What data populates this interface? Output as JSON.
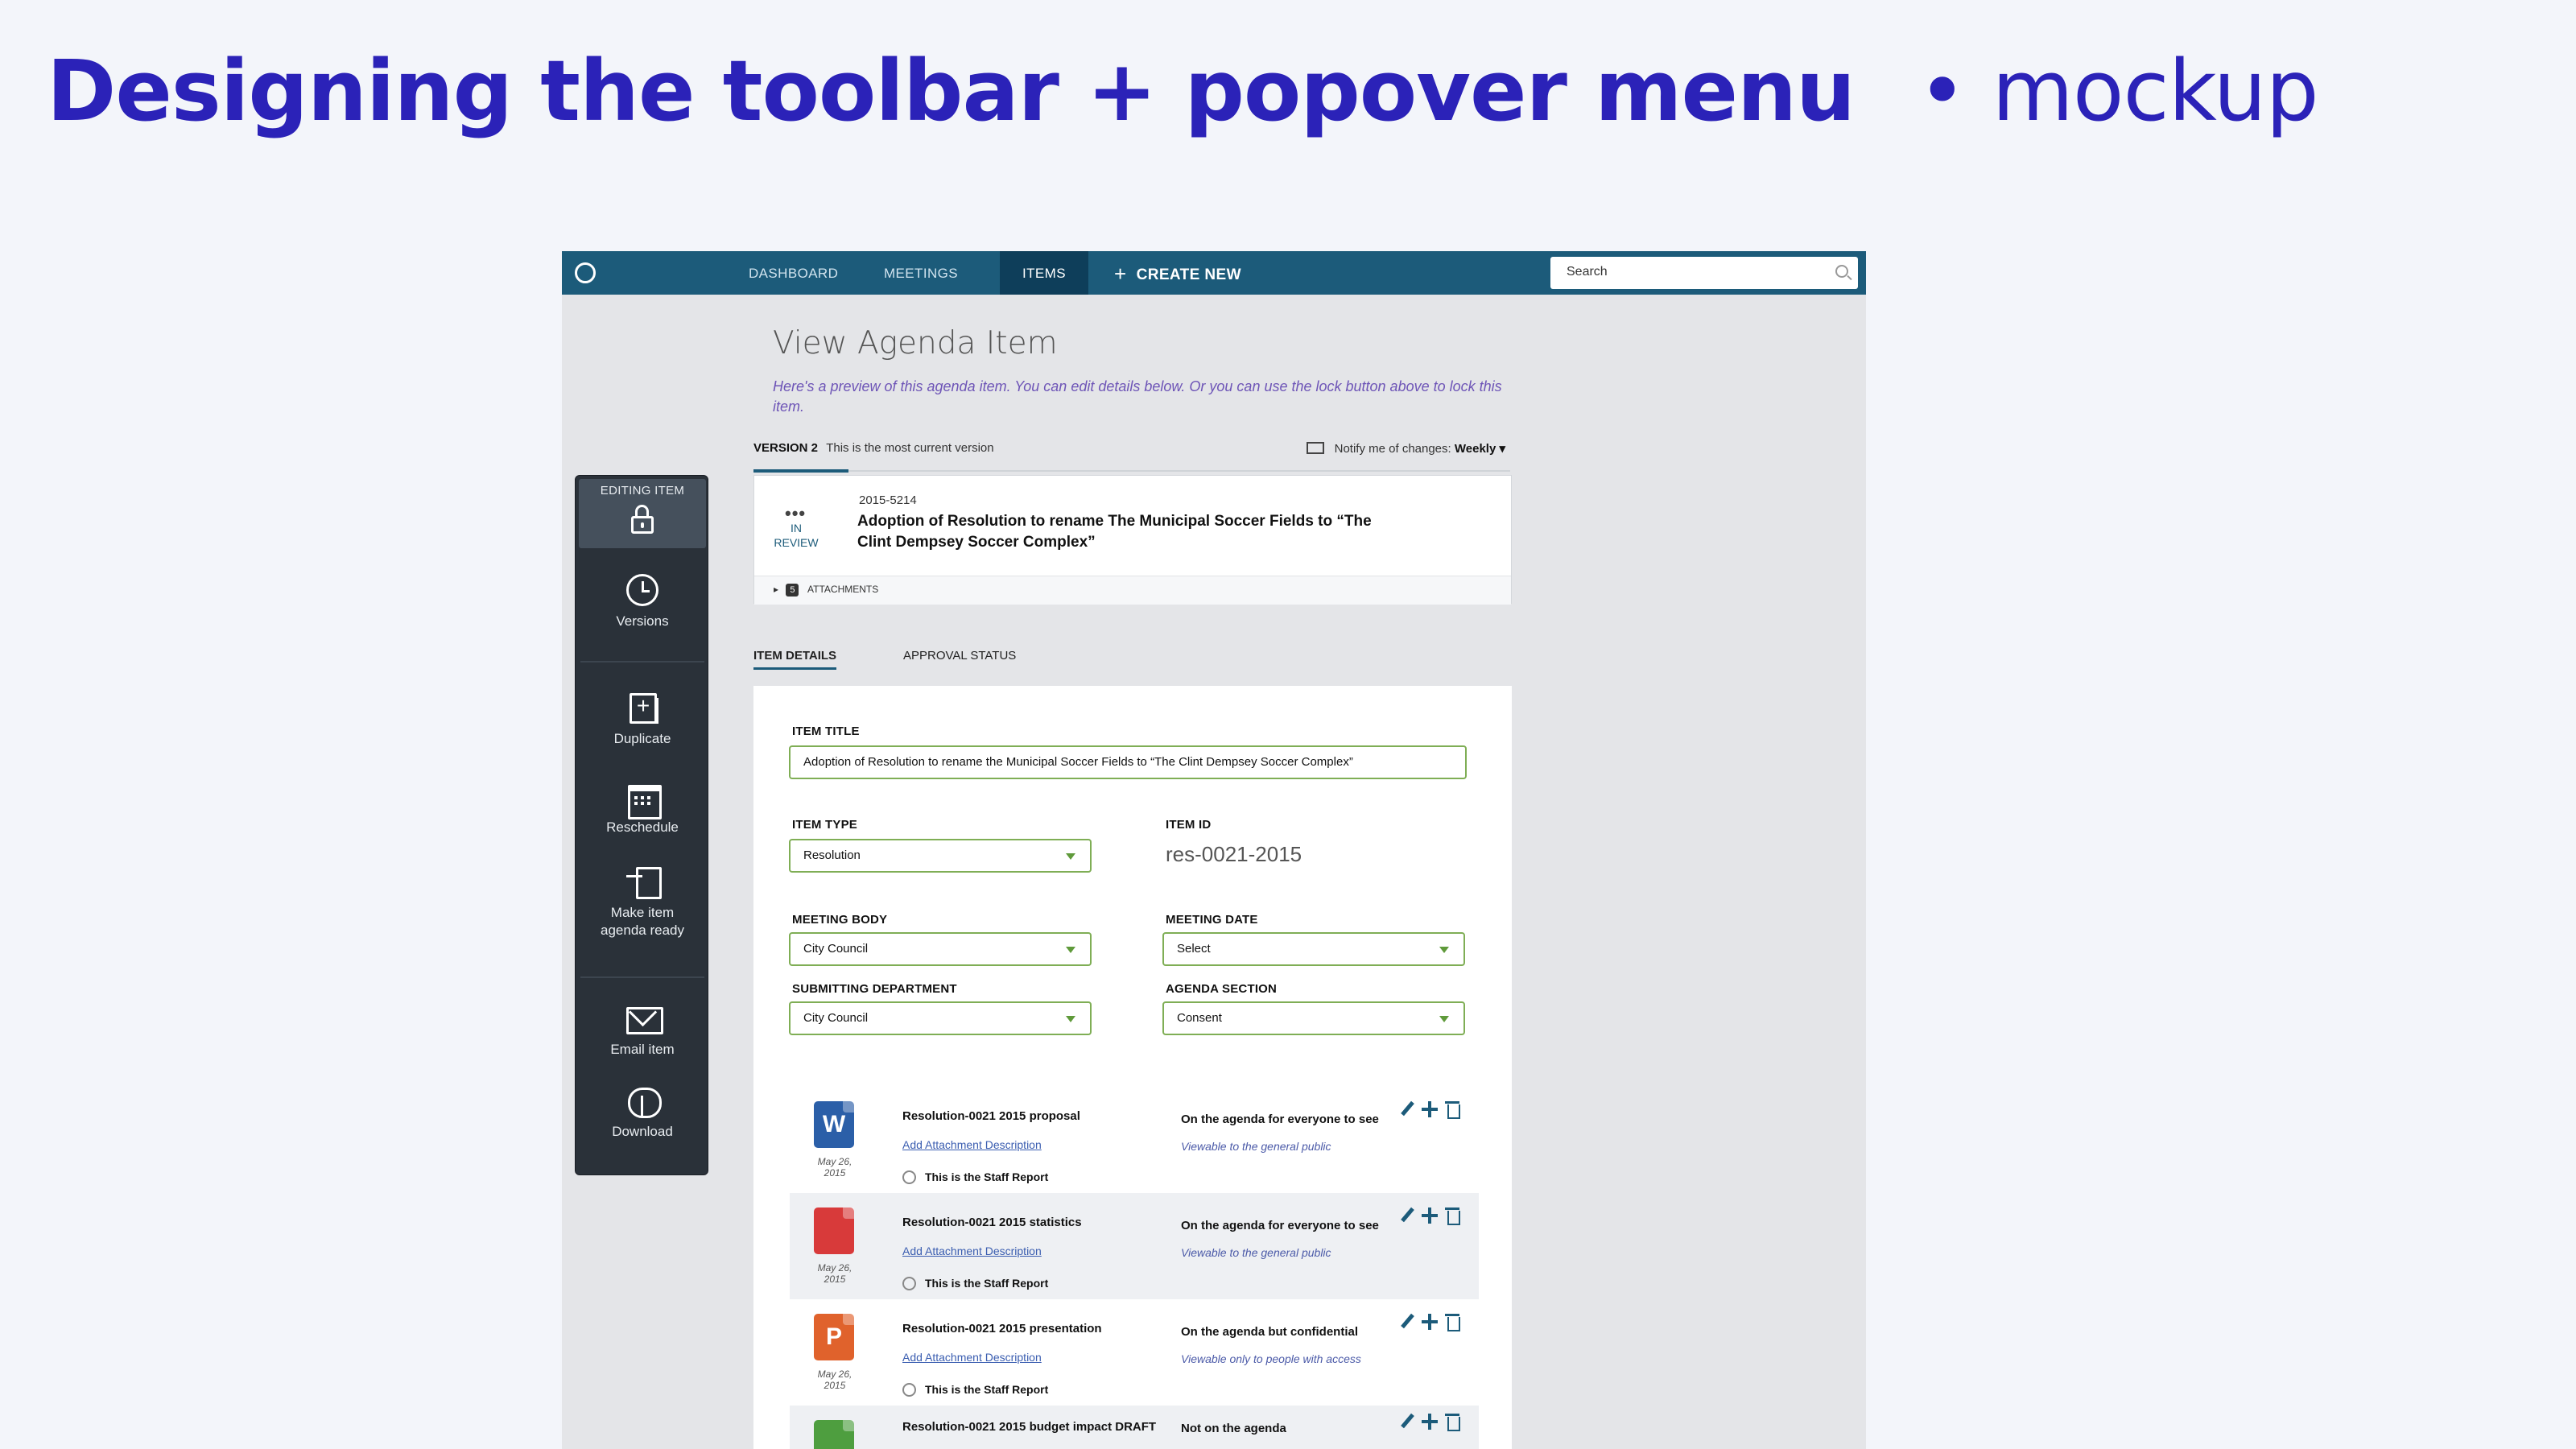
{
  "slide": {
    "title": "Designing the toolbar + popover menu",
    "separator": "•",
    "subtitle": "mockup"
  },
  "nav": {
    "items": [
      "DASHBOARD",
      "MEETINGS",
      "ITEMS"
    ],
    "active": "ITEMS",
    "create_plus": "+",
    "create_label": "CREATE NEW",
    "search_placeholder": "Search"
  },
  "page": {
    "heading": "View Agenda Item",
    "intro": "Here's a preview of this agenda item. You can edit details below. Or you can use the lock button above to lock this item.",
    "version_label": "VERSION 2",
    "version_note": "This is the most current version",
    "notify_label": "Notify me of changes:",
    "notify_value": "Weekly ▾"
  },
  "item": {
    "dots": "•••",
    "status": "IN REVIEW",
    "number": "2015-5214",
    "title": "Adoption of Resolution to rename The Municipal Soccer Fields to “The Clint Dempsey Soccer Complex”",
    "attachments_toggle": "▸",
    "attachments_count": "5",
    "attachments_label": "ATTACHMENTS"
  },
  "tabs": [
    "ITEM DETAILS",
    "APPROVAL STATUS"
  ],
  "form": {
    "item_title_label": "ITEM TITLE",
    "item_title_value": "Adoption of Resolution to rename the Municipal Soccer Fields to “The Clint Dempsey Soccer Complex”",
    "item_type_label": "ITEM TYPE",
    "item_type_value": "Resolution",
    "item_id_label": "ITEM ID",
    "item_id_value": "res-0021-2015",
    "meeting_body_label": "MEETING BODY",
    "meeting_body_value": "City Council",
    "meeting_date_label": "MEETING DATE",
    "meeting_date_value": "Select",
    "dept_label": "SUBMITTING DEPARTMENT",
    "dept_value": "City Council",
    "section_label": "AGENDA SECTION",
    "section_value": "Consent"
  },
  "attachments": [
    {
      "icon": "W",
      "color": "#2b5fa8",
      "date": "May 26, 2015",
      "name": "Resolution-0021 2015 proposal",
      "desc": "Add Attachment Description",
      "staff": "This is the Staff Report",
      "visibility": "On the agenda for everyone to see",
      "visibility_note": "Viewable to the general public"
    },
    {
      "icon": "",
      "color": "#d83a3a",
      "date": "May 26, 2015",
      "name": "Resolution-0021 2015 statistics",
      "desc": "Add Attachment Description",
      "staff": "This is the Staff Report",
      "visibility": "On the agenda for everyone to see",
      "visibility_note": "Viewable to the general public"
    },
    {
      "icon": "P",
      "color": "#e0622c",
      "date": "May 26, 2015",
      "name": "Resolution-0021 2015 presentation",
      "desc": "Add Attachment Description",
      "staff": "This is the Staff Report",
      "visibility": "On the agenda but confidential",
      "visibility_note": "Viewable only to people with access"
    },
    {
      "icon": "",
      "color": "#4e9e3f",
      "date": "",
      "name": "Resolution-0021 2015 budget impact DRAFT",
      "desc": "",
      "staff": "",
      "visibility": "Not on the agenda",
      "visibility_note": ""
    }
  ],
  "toolbar": {
    "editing_label": "EDITING ITEM",
    "versions": "Versions",
    "duplicate": "Duplicate",
    "reschedule": "Reschedule",
    "ready_line1": "Make item",
    "ready_line2": "agenda ready",
    "email": "Email item",
    "download": "Download"
  },
  "colors": {
    "title": "#2b22b8",
    "nav": "#1c5b7a",
    "toolbar": "#2a3139",
    "input_border": "#7fae55"
  }
}
